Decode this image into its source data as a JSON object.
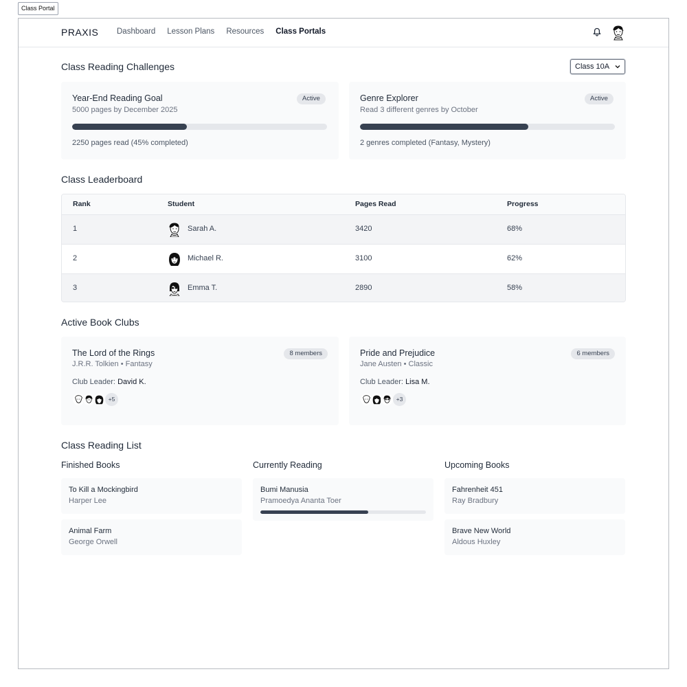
{
  "tab": {
    "label": "Class Portal"
  },
  "nav": {
    "brand": "PRAXIS",
    "links": [
      "Dashboard",
      "Lesson Plans",
      "Resources",
      "Class Portals"
    ],
    "active_link": "Class Portals"
  },
  "challenges": {
    "title": "Class Reading Challenges",
    "class_select": {
      "value": "Class 10A"
    },
    "items": [
      {
        "title": "Year-End Reading Goal",
        "subtitle": "5000 pages by December 2025",
        "badge": "Active",
        "progress": 0.45,
        "status": "2250 pages read (45% completed)"
      },
      {
        "title": "Genre Explorer",
        "subtitle": "Read 3 different genres by October",
        "badge": "Active",
        "progress": 0.66,
        "status": "2 genres completed (Fantasy, Mystery)"
      }
    ]
  },
  "leaderboard": {
    "title": "Class Leaderboard",
    "columns": [
      "Rank",
      "Student",
      "Pages Read",
      "Progress"
    ],
    "rows": [
      {
        "rank": "1",
        "student": "Sarah A.",
        "pages": "3420",
        "progress": "68%"
      },
      {
        "rank": "2",
        "student": "Michael R.",
        "pages": "3100",
        "progress": "62%"
      },
      {
        "rank": "3",
        "student": "Emma T.",
        "pages": "2890",
        "progress": "58%"
      }
    ]
  },
  "book_clubs": {
    "title": "Active Book Clubs",
    "leader_label": "Club Leader:",
    "items": [
      {
        "title": "The Lord of the Rings",
        "subtitle": "J.R.R. Tolkien • Fantasy",
        "members": "8 members",
        "leader": "David K.",
        "more": "+5"
      },
      {
        "title": "Pride and Prejudice",
        "subtitle": "Jane Austen • Classic",
        "members": "6 members",
        "leader": "Lisa M.",
        "more": "+3"
      }
    ]
  },
  "reading_list": {
    "title": "Class Reading List",
    "finished": {
      "title": "Finished Books",
      "books": [
        {
          "title": "To Kill a Mockingbird",
          "author": "Harper Lee"
        },
        {
          "title": "Animal Farm",
          "author": "George Orwell"
        }
      ]
    },
    "current": {
      "title": "Currently Reading",
      "books": [
        {
          "title": "Bumi Manusia",
          "author": "Pramoedya Ananta Toer",
          "progress": 0.65
        }
      ]
    },
    "upcoming": {
      "title": "Upcoming Books",
      "books": [
        {
          "title": "Fahrenheit 451",
          "author": "Ray Bradbury"
        },
        {
          "title": "Brave New World",
          "author": "Aldous Huxley"
        }
      ]
    }
  },
  "icons": {
    "bell": "bell-icon",
    "avatar": "avatar-icon",
    "chevron": "chevron-down-icon"
  },
  "colors": {
    "progress_fill": "#374151",
    "progress_track": "#e5e7eb",
    "card_bg": "#f9fafb"
  }
}
